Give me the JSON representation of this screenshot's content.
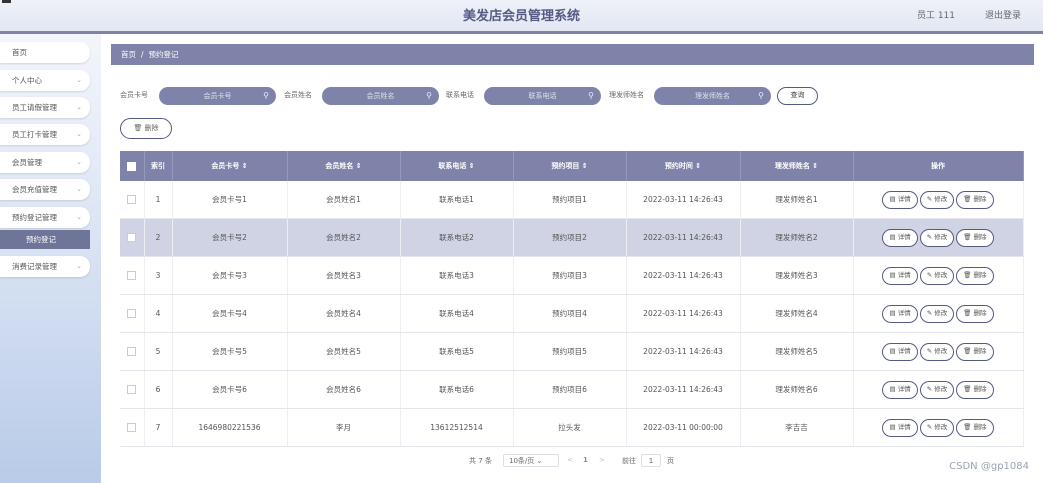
{
  "header": {
    "title": "美发店会员管理系统",
    "user": "员工 111",
    "logout": "退出登录"
  },
  "sidebar": {
    "items": [
      {
        "label": "首页",
        "chevron": false
      },
      {
        "label": "个人中心",
        "chevron": true
      },
      {
        "label": "员工请假管理",
        "chevron": true
      },
      {
        "label": "员工打卡管理",
        "chevron": true
      },
      {
        "label": "会员管理",
        "chevron": true
      },
      {
        "label": "会员充值管理",
        "chevron": true
      },
      {
        "label": "预约登记管理",
        "chevron": true
      },
      {
        "label": "消费记录管理",
        "chevron": true
      }
    ],
    "active_sub": "预约登记"
  },
  "breadcrumb": {
    "home": "首页",
    "sep": "/",
    "current": "预约登记"
  },
  "search": {
    "fields": [
      {
        "label": "会员卡号",
        "placeholder": "会员卡号"
      },
      {
        "label": "会员姓名",
        "placeholder": "会员姓名"
      },
      {
        "label": "联系电话",
        "placeholder": "联系电话"
      },
      {
        "label": "理发师姓名",
        "placeholder": "理发师姓名"
      }
    ],
    "query_label": "查询"
  },
  "delete_label": "删除",
  "table": {
    "columns": [
      "索引",
      "会员卡号 ⇕",
      "会员姓名 ⇕",
      "联系电话 ⇕",
      "预约项目 ⇕",
      "预约时间 ⇕",
      "理发师姓名 ⇕",
      "操作"
    ],
    "rows": [
      [
        "1",
        "会员卡号1",
        "会员姓名1",
        "联系电话1",
        "预约项目1",
        "2022-03-11 14:26:43",
        "理发师姓名1"
      ],
      [
        "2",
        "会员卡号2",
        "会员姓名2",
        "联系电话2",
        "预约项目2",
        "2022-03-11 14:26:43",
        "理发师姓名2"
      ],
      [
        "3",
        "会员卡号3",
        "会员姓名3",
        "联系电话3",
        "预约项目3",
        "2022-03-11 14:26:43",
        "理发师姓名3"
      ],
      [
        "4",
        "会员卡号4",
        "会员姓名4",
        "联系电话4",
        "预约项目4",
        "2022-03-11 14:26:43",
        "理发师姓名4"
      ],
      [
        "5",
        "会员卡号5",
        "会员姓名5",
        "联系电话5",
        "预约项目5",
        "2022-03-11 14:26:43",
        "理发师姓名5"
      ],
      [
        "6",
        "会员卡号6",
        "会员姓名6",
        "联系电话6",
        "预约项目6",
        "2022-03-11 14:26:43",
        "理发师姓名6"
      ],
      [
        "7",
        "1646980221536",
        "李月",
        "13612512514",
        "拉头发",
        "2022-03-11 00:00:00",
        "李吉吉"
      ]
    ],
    "actions": [
      "详情",
      "修改",
      "删除"
    ]
  },
  "pager": {
    "total": "共 7 条",
    "size": "10条/页",
    "prev": "<",
    "page": "1",
    "next": ">",
    "goto": "前往",
    "goto_value": "1",
    "unit": "页"
  },
  "watermark": "CSDN @gp1084",
  "colors": {
    "accent": "#7f83a9",
    "dark_accent": "#555a84",
    "highlight_row": "#cfd3e4"
  }
}
